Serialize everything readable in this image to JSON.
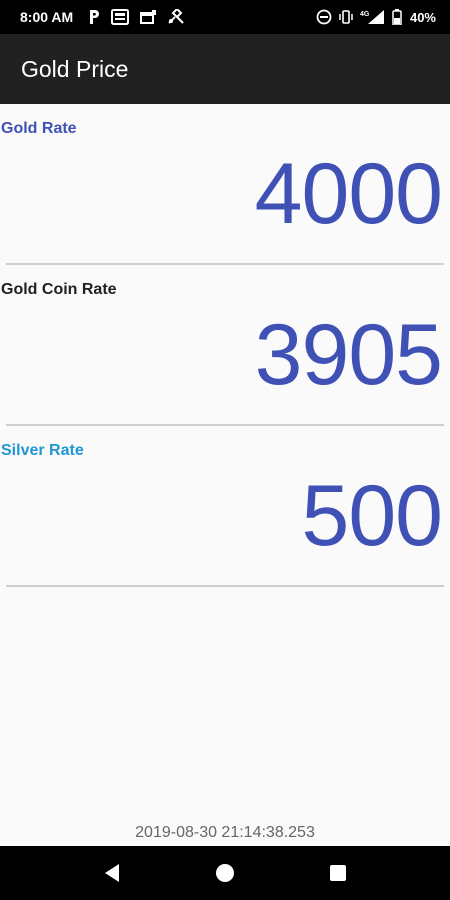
{
  "status_bar": {
    "time": "8:00 AM",
    "left_icons": [
      "parking-icon",
      "news-icon",
      "calendar-icon",
      "satellite-icon"
    ],
    "right_icons": [
      "dnd-icon",
      "vibrate-icon",
      "signal-4g-icon",
      "battery-icon"
    ],
    "network": "4G",
    "battery": "40%"
  },
  "app_bar": {
    "title": "Gold Price"
  },
  "rates": [
    {
      "label": "Gold Rate",
      "value": "4000",
      "label_color": "#3f51b5"
    },
    {
      "label": "Gold Coin Rate",
      "value": "3905",
      "label_color": "#212121"
    },
    {
      "label": "Silver Rate",
      "value": "500",
      "label_color": "#2196d3"
    }
  ],
  "value_color": "#3f51b5",
  "footer": {
    "timestamp": "2019-08-30 21:14:38.253"
  },
  "nav_bar": {
    "buttons": [
      "back-icon",
      "home-icon",
      "recents-icon"
    ]
  }
}
